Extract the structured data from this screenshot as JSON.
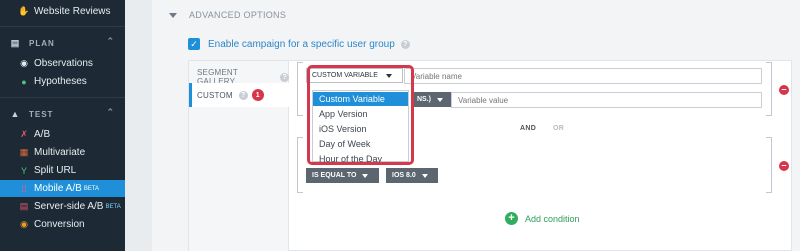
{
  "sidebar": {
    "top_item": "Website Reviews",
    "plan": {
      "label": "PLAN",
      "items": [
        "Observations",
        "Hypotheses"
      ]
    },
    "test": {
      "label": "TEST",
      "items": [
        "A/B",
        "Multivariate",
        "Split URL",
        "Mobile A/B",
        "Server-side A/B",
        "Conversion"
      ]
    },
    "mobile_badge": "BETA",
    "server_badge": "BETA"
  },
  "advanced": {
    "label": "ADVANCED OPTIONS"
  },
  "enable_label": "Enable campaign for a specific user group",
  "gallery": {
    "segment_gallery": "SEGMENT GALLERY",
    "custom": "CUSTOM",
    "badge": "1"
  },
  "condition1": {
    "dropdown": "CUSTOM VARIABLE",
    "name_placeholder": "Variable name",
    "operator_partial": "NS.)",
    "value_placeholder": "Variable value"
  },
  "connectors": {
    "and": "AND",
    "or": "OR"
  },
  "condition2": {
    "operator": "IS EQUAL TO",
    "value": "IOS 8.0"
  },
  "menu_options": [
    "Custom Variable",
    "App Version",
    "iOS Version",
    "Day of Week",
    "Hour of the Day"
  ],
  "add_condition": "Add condition",
  "colors": {
    "accent": "#1e8fd8",
    "highlight": "#d5374c",
    "success": "#2fae60",
    "sidebar": "#1d2a35"
  }
}
